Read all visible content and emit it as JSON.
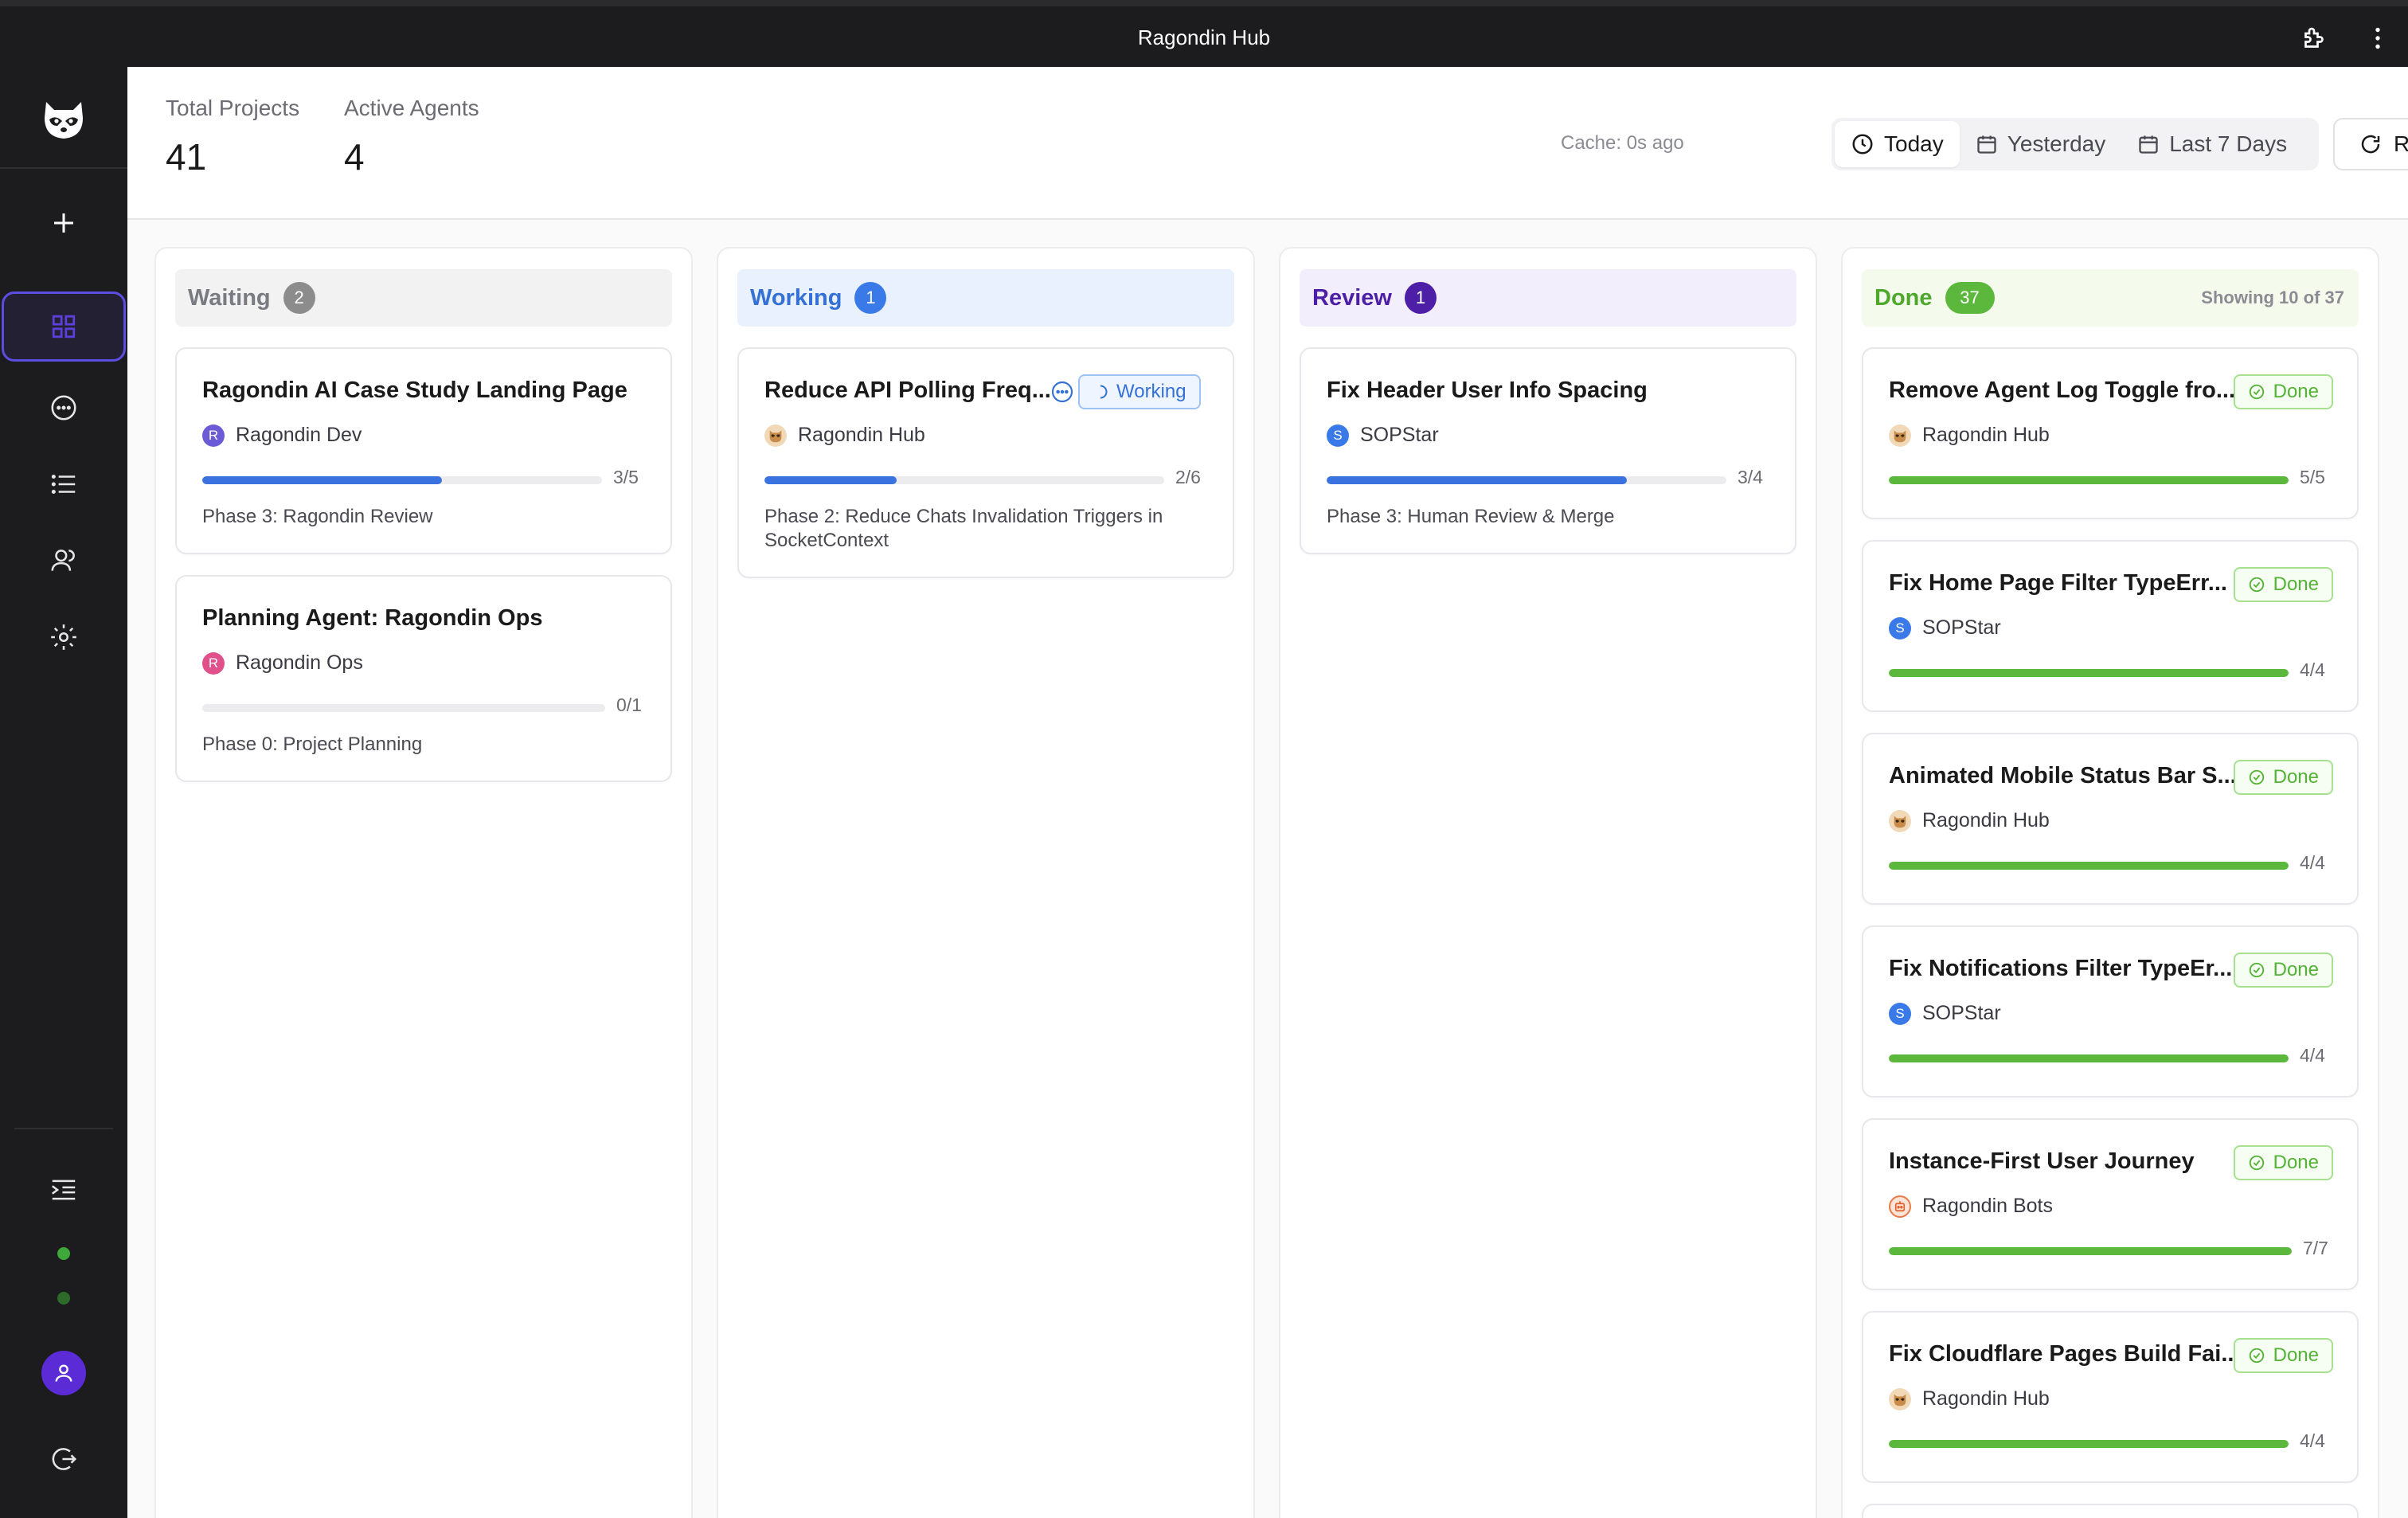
{
  "window": {
    "title": "Ragondin Hub"
  },
  "header": {
    "stats": [
      {
        "label": "Total Projects",
        "value": "41"
      },
      {
        "label": "Active Agents",
        "value": "4"
      }
    ],
    "cache_text": "Cache: 0s ago",
    "ranges": [
      {
        "label": "Today",
        "icon": "clock-icon",
        "selected": true
      },
      {
        "label": "Yesterday",
        "icon": "calendar-icon",
        "selected": false
      },
      {
        "label": "Last 7 Days",
        "icon": "calendar-icon",
        "selected": false
      }
    ],
    "refresh_label": "Refresh"
  },
  "colors": {
    "waiting": "#8c8c8c",
    "working": "#3a7ae8",
    "review": "#4c1fa6",
    "done": "#5cb83c",
    "sidebar": "#1c1c1e",
    "online": "#3fa83a"
  },
  "columns": {
    "waiting": {
      "title": "Waiting",
      "count": "2",
      "cards": [
        {
          "title": "Ragondin AI Case Study Landing Page",
          "project": "Ragondin Dev",
          "avatar": "R",
          "progress": "3/5",
          "phase": "Phase 3: Ragondin Review"
        },
        {
          "title": "Planning Agent: Ragondin Ops",
          "project": "Ragondin Ops",
          "avatar": "R",
          "progress": "0/1",
          "phase": "Phase 0: Project Planning"
        }
      ]
    },
    "working": {
      "title": "Working",
      "count": "1",
      "cards": [
        {
          "title": "Reduce API Polling Freq...",
          "project": "Ragondin Hub",
          "badge": "Working",
          "progress": "2/6",
          "phase": "Phase 2: Reduce Chats Invalidation Triggers in SocketContext"
        }
      ]
    },
    "review": {
      "title": "Review",
      "count": "1",
      "cards": [
        {
          "title": "Fix Header User Info Spacing",
          "project": "SOPStar",
          "avatar": "S",
          "progress": "3/4",
          "phase": "Phase 3: Human Review & Merge"
        }
      ]
    },
    "done": {
      "title": "Done",
      "count": "37",
      "showing": "Showing 10 of 37",
      "cards": [
        {
          "title": "Remove Agent Log Toggle fro...",
          "project": "Ragondin Hub",
          "badge": "Done",
          "progress": "5/5"
        },
        {
          "title": "Fix Home Page Filter TypeErr...",
          "project": "SOPStar",
          "avatar": "S",
          "badge": "Done",
          "progress": "4/4"
        },
        {
          "title": "Animated Mobile Status Bar S...",
          "project": "Ragondin Hub",
          "badge": "Done",
          "progress": "4/4"
        },
        {
          "title": "Fix Notifications Filter TypeEr...",
          "project": "SOPStar",
          "avatar": "S",
          "badge": "Done",
          "progress": "4/4"
        },
        {
          "title": "Instance-First User Journey",
          "project": "Ragondin Bots",
          "badge": "Done",
          "progress": "7/7"
        },
        {
          "title": "Fix Cloudflare Pages Build Fai...",
          "project": "Ragondin Hub",
          "badge": "Done",
          "progress": "4/4"
        }
      ]
    }
  }
}
